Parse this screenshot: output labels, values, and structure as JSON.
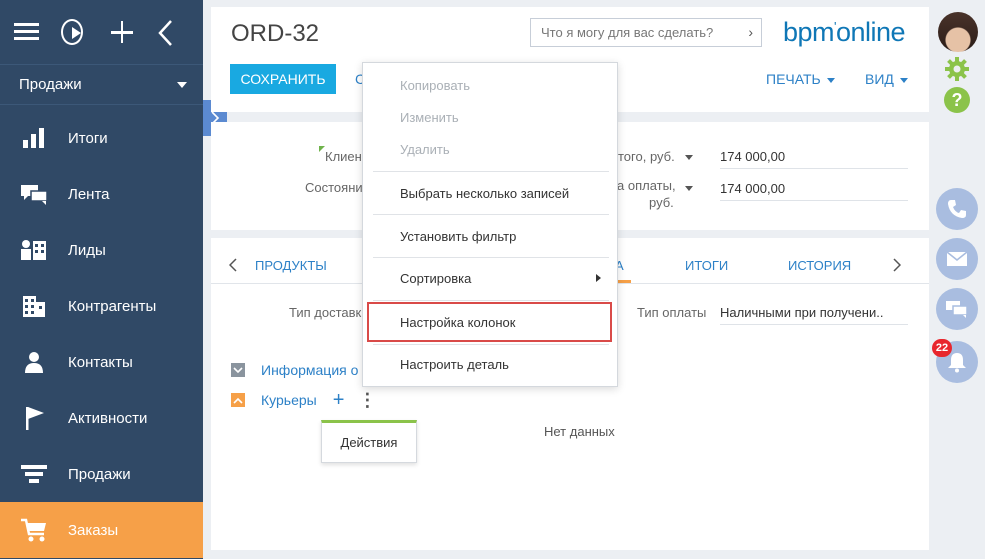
{
  "sidebar": {
    "section": "Продажи",
    "items": [
      {
        "label": "Итоги",
        "icon": "bar-chart-icon"
      },
      {
        "label": "Лента",
        "icon": "chat-bubbles-icon"
      },
      {
        "label": "Лиды",
        "icon": "leads-icon"
      },
      {
        "label": "Контрагенты",
        "icon": "building-icon"
      },
      {
        "label": "Контакты",
        "icon": "person-icon"
      },
      {
        "label": "Активности",
        "icon": "flag-icon"
      },
      {
        "label": "Продажи",
        "icon": "funnel-icon"
      },
      {
        "label": "Заказы",
        "icon": "cart-icon"
      }
    ]
  },
  "header": {
    "title": "ORD-32",
    "search_placeholder": "Что я могу для вас сделать?",
    "logo": "bpm'online",
    "save_label": "СОХРАНИТЬ",
    "cancel_partial": "С",
    "print_label": "ПЕЧАТЬ",
    "view_label": "ВИД"
  },
  "info": {
    "client_label": "Клиен",
    "state_label": "Состояни",
    "total_label": "того, руб.",
    "total_value": "174 000,00",
    "payment_label_1": "а оплаты,",
    "payment_label_2": "руб.",
    "payment_value": "174 000,00"
  },
  "tabs": {
    "products": "ПРОДУКТЫ",
    "active_partial": "А",
    "totals": "ИТОГИ",
    "history": "ИСТОРИЯ"
  },
  "delivery": {
    "delivery_type_label": "Тип доставк",
    "payment_type_label": "Тип оплаты",
    "payment_type_value": "Наличными при получени..",
    "group_info": "Информация о",
    "group_couriers": "Курьеры",
    "no_data": "Нет данных",
    "actions_tooltip": "Действия"
  },
  "dropdown": {
    "items": [
      {
        "label": "Копировать",
        "disabled": true
      },
      {
        "label": "Изменить",
        "disabled": true
      },
      {
        "label": "Удалить",
        "disabled": true
      },
      {
        "label": "Выбрать несколько записей",
        "disabled": false
      },
      {
        "label": "Установить фильтр",
        "disabled": false
      },
      {
        "label": "Сортировка",
        "disabled": false
      },
      {
        "label": "Настройка колонок",
        "disabled": false
      },
      {
        "label": "Настроить деталь",
        "disabled": false
      }
    ]
  },
  "rail": {
    "notification_count": "22"
  },
  "colors": {
    "sidebar": "#304966",
    "active": "#f6a048",
    "accent": "#19a9e1",
    "link": "#2d81c7",
    "highlight": "#d94a48"
  }
}
